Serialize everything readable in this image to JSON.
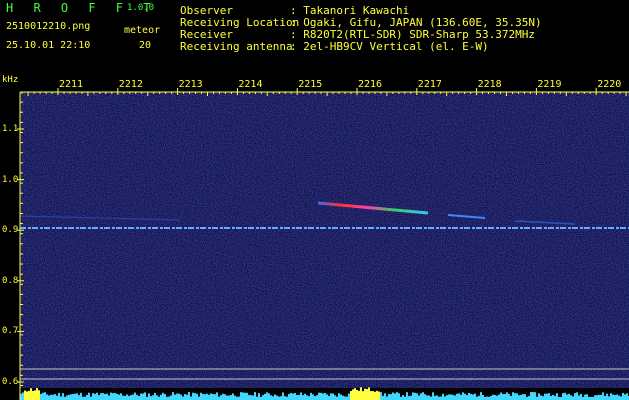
{
  "app": {
    "title": "H R O F F T",
    "version": "1.0.0"
  },
  "file": {
    "name": "2510012210.png",
    "datetime": "25.10.01 22:10"
  },
  "counter": {
    "label": "meteor",
    "value": "20"
  },
  "station": [
    {
      "label": "Observer",
      "value": ": Takanori Kawachi"
    },
    {
      "label": "Receiving Location",
      "value": ": Ogaki, Gifu, JAPAN (136.60E, 35.35N)"
    },
    {
      "label": "Receiver",
      "value": ": R820T2(RTL-SDR) SDR-Sharp 53.372MHz"
    },
    {
      "label": "Receiving antenna",
      "value": ": 2el-HB9CV Vertical (el. E-W)"
    }
  ],
  "axis": {
    "y_unit": "kHz",
    "x_ticks": [
      "2211",
      "2212",
      "2213",
      "2214",
      "2215",
      "2216",
      "2217",
      "2218",
      "2219",
      "2220"
    ],
    "y_ticks": [
      "1.1",
      "1.0",
      "0.9",
      "0.8",
      "0.7",
      "0.6"
    ]
  },
  "colors": {
    "header_text": "#3cff3c",
    "axis_text": "#ffff3c",
    "info_text": "#e8e8e8",
    "background": "#000000",
    "noise": "#1a1a6e"
  }
}
